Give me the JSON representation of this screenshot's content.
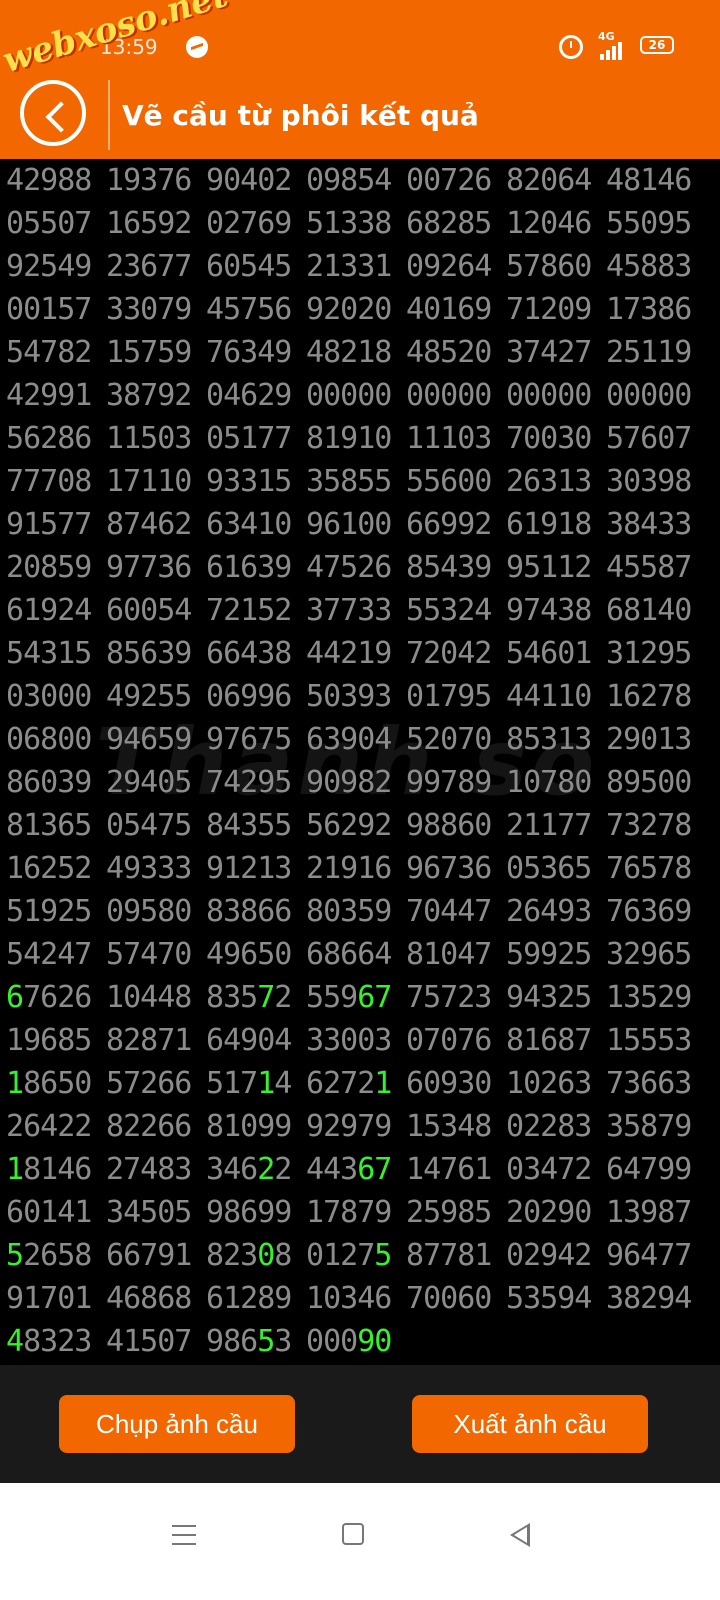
{
  "status_bar": {
    "time": "13:59",
    "network": "4G",
    "battery": "26"
  },
  "watermark_top": "webxoso.net",
  "watermark_center": "Thanh so",
  "header": {
    "title": "Vẽ cầu từ phôi kết quả",
    "back_icon": "chevron-left-icon"
  },
  "colors": {
    "accent": "#F26700",
    "highlight": "#35F22B",
    "digit": "#8C8C8C"
  },
  "rows": [
    [
      "42988",
      "19376",
      "90402",
      "09854",
      "00726",
      "82064",
      "48146"
    ],
    [
      "05507",
      "16592",
      "02769",
      "51338",
      "68285",
      "12046",
      "55095"
    ],
    [
      "92549",
      "23677",
      "60545",
      "21331",
      "09264",
      "57860",
      "45883"
    ],
    [
      "00157",
      "33079",
      "45756",
      "92020",
      "40169",
      "71209",
      "17386"
    ],
    [
      "54782",
      "15759",
      "76349",
      "48218",
      "48520",
      "37427",
      "25119"
    ],
    [
      "42991",
      "38792",
      "04629",
      "00000",
      "00000",
      "00000",
      "00000"
    ],
    [
      "56286",
      "11503",
      "05177",
      "81910",
      "11103",
      "70030",
      "57607"
    ],
    [
      "77708",
      "17110",
      "93315",
      "35855",
      "55600",
      "26313",
      "30398"
    ],
    [
      "91577",
      "87462",
      "63410",
      "96100",
      "66992",
      "61918",
      "38433"
    ],
    [
      "20859",
      "97736",
      "61639",
      "47526",
      "85439",
      "95112",
      "45587"
    ],
    [
      "61924",
      "60054",
      "72152",
      "37733",
      "55324",
      "97438",
      "68140"
    ],
    [
      "54315",
      "85639",
      "66438",
      "44219",
      "72042",
      "54601",
      "31295"
    ],
    [
      "03000",
      "49255",
      "06996",
      "50393",
      "01795",
      "44110",
      "16278"
    ],
    [
      "06800",
      "94659",
      "97675",
      "63904",
      "52070",
      "85313",
      "29013"
    ],
    [
      "86039",
      "29405",
      "74295",
      "90982",
      "99789",
      "10780",
      "89500"
    ],
    [
      "81365",
      "05475",
      "84355",
      "56292",
      "98860",
      "21177",
      "73278"
    ],
    [
      "16252",
      "49333",
      "91213",
      "21916",
      "96736",
      "05365",
      "76578"
    ],
    [
      "51925",
      "09580",
      "83866",
      "80359",
      "70447",
      "26493",
      "76369"
    ],
    [
      "54247",
      "57470",
      "49650",
      "68664",
      "81047",
      "59925",
      "32965"
    ],
    [
      "67626",
      "10448",
      "83572",
      "55967",
      "75723",
      "94325",
      "13529"
    ],
    [
      "19685",
      "82871",
      "64904",
      "33003",
      "07076",
      "81687",
      "15553"
    ],
    [
      "18650",
      "57266",
      "51714",
      "62721",
      "60930",
      "10263",
      "73663"
    ],
    [
      "26422",
      "82266",
      "81099",
      "92979",
      "15348",
      "02283",
      "35879"
    ],
    [
      "18146",
      "27483",
      "34622",
      "44367",
      "14761",
      "03472",
      "64799"
    ],
    [
      "60141",
      "34505",
      "98699",
      "17879",
      "25985",
      "20290",
      "13987"
    ],
    [
      "52658",
      "66791",
      "82308",
      "01275",
      "87781",
      "02942",
      "96477"
    ],
    [
      "91701",
      "46868",
      "61289",
      "10346",
      "70060",
      "53594",
      "38294"
    ],
    [
      "48323",
      "41507",
      "98653",
      "00090"
    ]
  ],
  "highlights": [
    {
      "row": 19,
      "col": 0,
      "pos": [
        0
      ]
    },
    {
      "row": 19,
      "col": 2,
      "pos": [
        3
      ]
    },
    {
      "row": 19,
      "col": 3,
      "pos": [
        3,
        4
      ]
    },
    {
      "row": 21,
      "col": 0,
      "pos": [
        0
      ]
    },
    {
      "row": 21,
      "col": 2,
      "pos": [
        3
      ]
    },
    {
      "row": 21,
      "col": 3,
      "pos": [
        4
      ]
    },
    {
      "row": 23,
      "col": 0,
      "pos": [
        0
      ]
    },
    {
      "row": 23,
      "col": 2,
      "pos": [
        3
      ]
    },
    {
      "row": 23,
      "col": 3,
      "pos": [
        3,
        4
      ]
    },
    {
      "row": 25,
      "col": 0,
      "pos": [
        0
      ]
    },
    {
      "row": 25,
      "col": 2,
      "pos": [
        3
      ]
    },
    {
      "row": 25,
      "col": 3,
      "pos": [
        4
      ]
    },
    {
      "row": 27,
      "col": 0,
      "pos": [
        0
      ]
    },
    {
      "row": 27,
      "col": 2,
      "pos": [
        3
      ]
    },
    {
      "row": 27,
      "col": 3,
      "pos": [
        3,
        4
      ]
    }
  ],
  "buttons": {
    "capture": "Chụp ảnh cầu",
    "export": "Xuất ảnh cầu"
  },
  "nav": {
    "menu_icon": "menu-icon",
    "home_icon": "home-icon",
    "back_icon": "back-icon"
  }
}
